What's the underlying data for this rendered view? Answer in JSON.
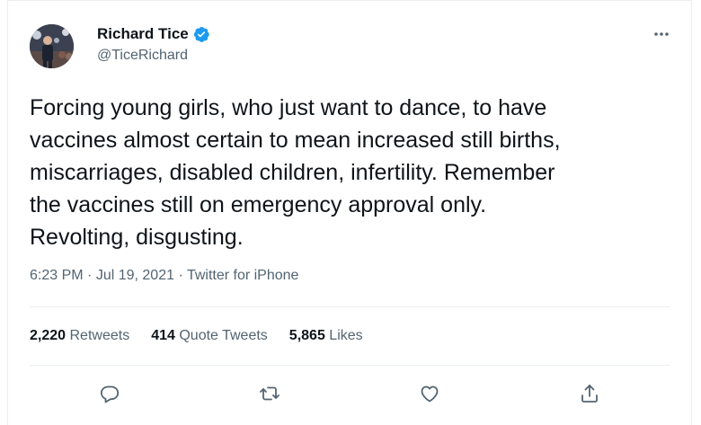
{
  "author": {
    "display_name": "Richard Tice",
    "handle": "@TiceRichard",
    "verified": true
  },
  "tweet": {
    "text": "Forcing young girls, who just want to dance, to have\nvaccines almost certain to mean increased still births,\nmiscarriages, disabled children, infertility. Remember\nthe vaccines still on emergency approval only.\nRevolting, disgusting.",
    "time": "6:23 PM",
    "separator": " · ",
    "date": "Jul 19, 2021",
    "source": "Twitter for iPhone"
  },
  "stats": {
    "retweets_count": "2,220",
    "retweets_label": "Retweets",
    "quotes_count": "414",
    "quotes_label": "Quote Tweets",
    "likes_count": "5,865",
    "likes_label": "Likes"
  },
  "icons": {
    "more": "more-icon",
    "reply": "reply-icon",
    "retweet": "retweet-icon",
    "like": "heart-icon",
    "share": "share-icon",
    "verified": "verified-badge-icon"
  },
  "colors": {
    "text_primary": "#0f1419",
    "text_secondary": "#536471",
    "verified_blue": "#1d9bf0",
    "divider": "#ebeef0"
  }
}
